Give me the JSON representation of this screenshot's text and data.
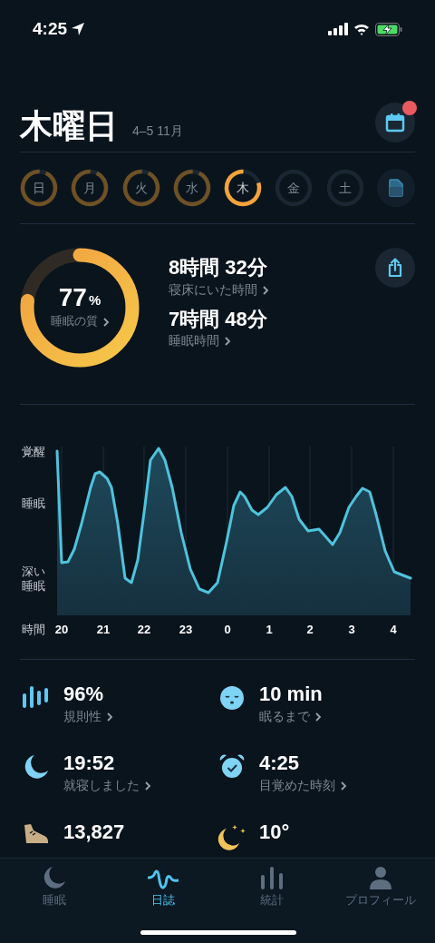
{
  "status_bar": {
    "time": "4:25"
  },
  "header": {
    "day": "木曜日",
    "date_range": "4–5 11月",
    "calendar_notification": true
  },
  "days": [
    {
      "label": "日",
      "recorded": true,
      "selected": false
    },
    {
      "label": "月",
      "recorded": true,
      "selected": false
    },
    {
      "label": "火",
      "recorded": true,
      "selected": false
    },
    {
      "label": "水",
      "recorded": true,
      "selected": false
    },
    {
      "label": "木",
      "recorded": true,
      "selected": true
    },
    {
      "label": "金",
      "recorded": false,
      "selected": false
    },
    {
      "label": "土",
      "recorded": false,
      "selected": false
    }
  ],
  "summary": {
    "quality": {
      "value": "77",
      "unit": "%",
      "label": "睡眠の質"
    },
    "metrics": [
      {
        "value": "8時間 32分",
        "label": "寝床にいた時間"
      },
      {
        "value": "7時間 48分",
        "label": "睡眠時間"
      }
    ]
  },
  "sleep_graph": {
    "y_labels": [
      "覚醒",
      "睡眠",
      "深い睡眠"
    ],
    "x_title": "時間",
    "x_labels": [
      "20",
      "21",
      "22",
      "23",
      "0",
      "1",
      "2",
      "3",
      "4"
    ]
  },
  "stats": [
    {
      "kind": "bars",
      "value": "96%",
      "label": "規則性"
    },
    {
      "kind": "face",
      "value": "10 min",
      "label": "眠るまで"
    },
    {
      "kind": "moon",
      "value": "19:52",
      "label": "就寝しました"
    },
    {
      "kind": "alarm",
      "value": "4:25",
      "label": "目覚めた時刻"
    },
    {
      "kind": "shoe",
      "value": "13,827"
    },
    {
      "kind": "weather",
      "value": "10°"
    }
  ],
  "tabs": [
    {
      "kind": "moon",
      "label": "睡眠",
      "selected": false
    },
    {
      "kind": "wave",
      "label": "日誌",
      "selected": true
    },
    {
      "kind": "bars",
      "label": "統計",
      "selected": false
    },
    {
      "kind": "person",
      "label": "プロフィール",
      "selected": false
    }
  ]
}
